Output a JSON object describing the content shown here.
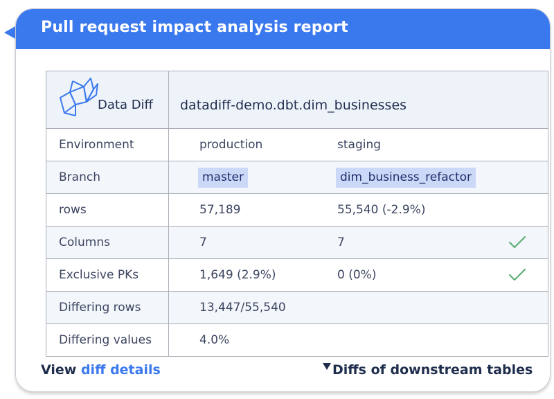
{
  "header": {
    "title": "Pull request impact analysis report",
    "color": "#3a78ee"
  },
  "logo": {
    "icon": "origami-bird-icon",
    "text": "Data Diff"
  },
  "table_name": "datadiff-demo.dbt.dim_businesses",
  "rows": [
    {
      "label": "Environment",
      "production": "production",
      "staging": "staging"
    },
    {
      "label": "Branch",
      "production": "master",
      "staging": "dim_business_refactor"
    },
    {
      "label": "rows",
      "production": "57,189",
      "staging": "55,540 (-2.9%)"
    },
    {
      "label": "Columns",
      "production": "7",
      "staging": "7",
      "status": "check-icon"
    },
    {
      "label": "Exclusive PKs",
      "production": "1,649 (2.9%)",
      "staging": "0 (0%)",
      "status": "check-icon"
    },
    {
      "label": "Differing rows",
      "production": "13,447/55,540",
      "staging": ""
    },
    {
      "label": "Differing values",
      "production": "4.0%",
      "staging": ""
    }
  ],
  "footer": {
    "view_prefix": "View",
    "view_link": "diff details",
    "downstream": "Diffs of downstream tables"
  },
  "colors": {
    "accent": "#3a78ee",
    "check": "#5fae76",
    "chip": "#cbd8f7"
  }
}
